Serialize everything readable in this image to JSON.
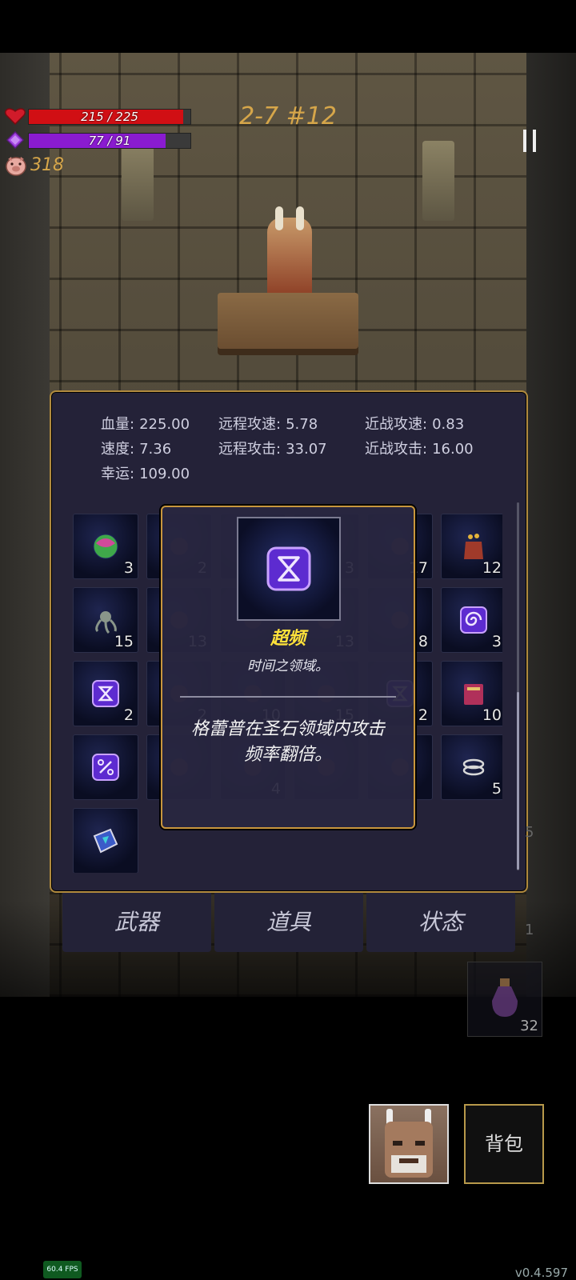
{
  "hud": {
    "hp_text": "215 / 225",
    "hp_fraction": 0.956,
    "mp_text": "77 / 91",
    "mp_fraction": 0.846,
    "gold": "318",
    "level": "2-7 #12",
    "colors": {
      "hp": "#d10f14",
      "mp": "#8a1bd0",
      "gold": "#d6a64a"
    }
  },
  "stats": {
    "row1": [
      {
        "label": "血量:",
        "value": "225.00"
      },
      {
        "label": "远程攻速:",
        "value": "5.78"
      },
      {
        "label": "近战攻速:",
        "value": "0.83"
      }
    ],
    "row2": [
      {
        "label": "速度:",
        "value": "7.36"
      },
      {
        "label": "远程攻击:",
        "value": "33.07"
      },
      {
        "label": "近战攻击:",
        "value": "16.00"
      }
    ],
    "row3": [
      {
        "label": "幸运:",
        "value": "109.00"
      }
    ]
  },
  "inventory": {
    "rows": [
      [
        {
          "icon": "gem-orb-icon",
          "count": "3"
        },
        {
          "icon": "flower-icon",
          "count": "2"
        },
        {
          "icon": "item-icon",
          "count": ""
        },
        {
          "icon": "item-icon",
          "count": "3"
        },
        {
          "icon": "crystal-icon",
          "count": "17"
        },
        {
          "icon": "bag-icon",
          "count": "12"
        }
      ],
      [
        {
          "icon": "tentacle-icon",
          "count": "15"
        },
        {
          "icon": "meat-icon",
          "count": "13"
        },
        {
          "icon": "item-icon",
          "count": ""
        },
        {
          "icon": "item-icon",
          "count": "13"
        },
        {
          "icon": "meat-icon",
          "count": "8"
        },
        {
          "icon": "spiral-rune-icon",
          "count": "3"
        }
      ],
      [
        {
          "icon": "hourglass-rune-icon",
          "count": "2"
        },
        {
          "icon": "eye-rune-icon",
          "count": "2"
        },
        {
          "icon": "beast-icon",
          "count": "10"
        },
        {
          "icon": "bottle-icon",
          "count": "15"
        },
        {
          "icon": "hourglass-rune-icon",
          "count": "2"
        },
        {
          "icon": "book-icon",
          "count": "10"
        }
      ],
      [
        {
          "icon": "percent-rune-icon",
          "count": ""
        },
        {
          "icon": "gauge-rune-icon",
          "count": ""
        },
        {
          "icon": "item-icon",
          "count": "4"
        },
        {
          "icon": "ghost-icon",
          "count": ""
        },
        {
          "icon": "berry-icon",
          "count": ""
        },
        {
          "icon": "rings-icon",
          "count": "5"
        }
      ],
      [
        {
          "icon": "tome-icon",
          "count": ""
        }
      ]
    ]
  },
  "tooltip": {
    "icon": "hourglass-rune-icon",
    "title": "超频",
    "subtitle": "时间之领域。",
    "description_line1": "格蕾普在圣石领域内攻击",
    "description_line2": "频率翻倍。"
  },
  "tabs": [
    {
      "label": "武器"
    },
    {
      "label": "道具"
    },
    {
      "label": "状态"
    }
  ],
  "right_side": {
    "peek_count_1": "5",
    "peek_count_2": "1",
    "potion_count": "32"
  },
  "bag_button": "背包",
  "fps": "60.4 FPS",
  "version": "v0.4.597"
}
